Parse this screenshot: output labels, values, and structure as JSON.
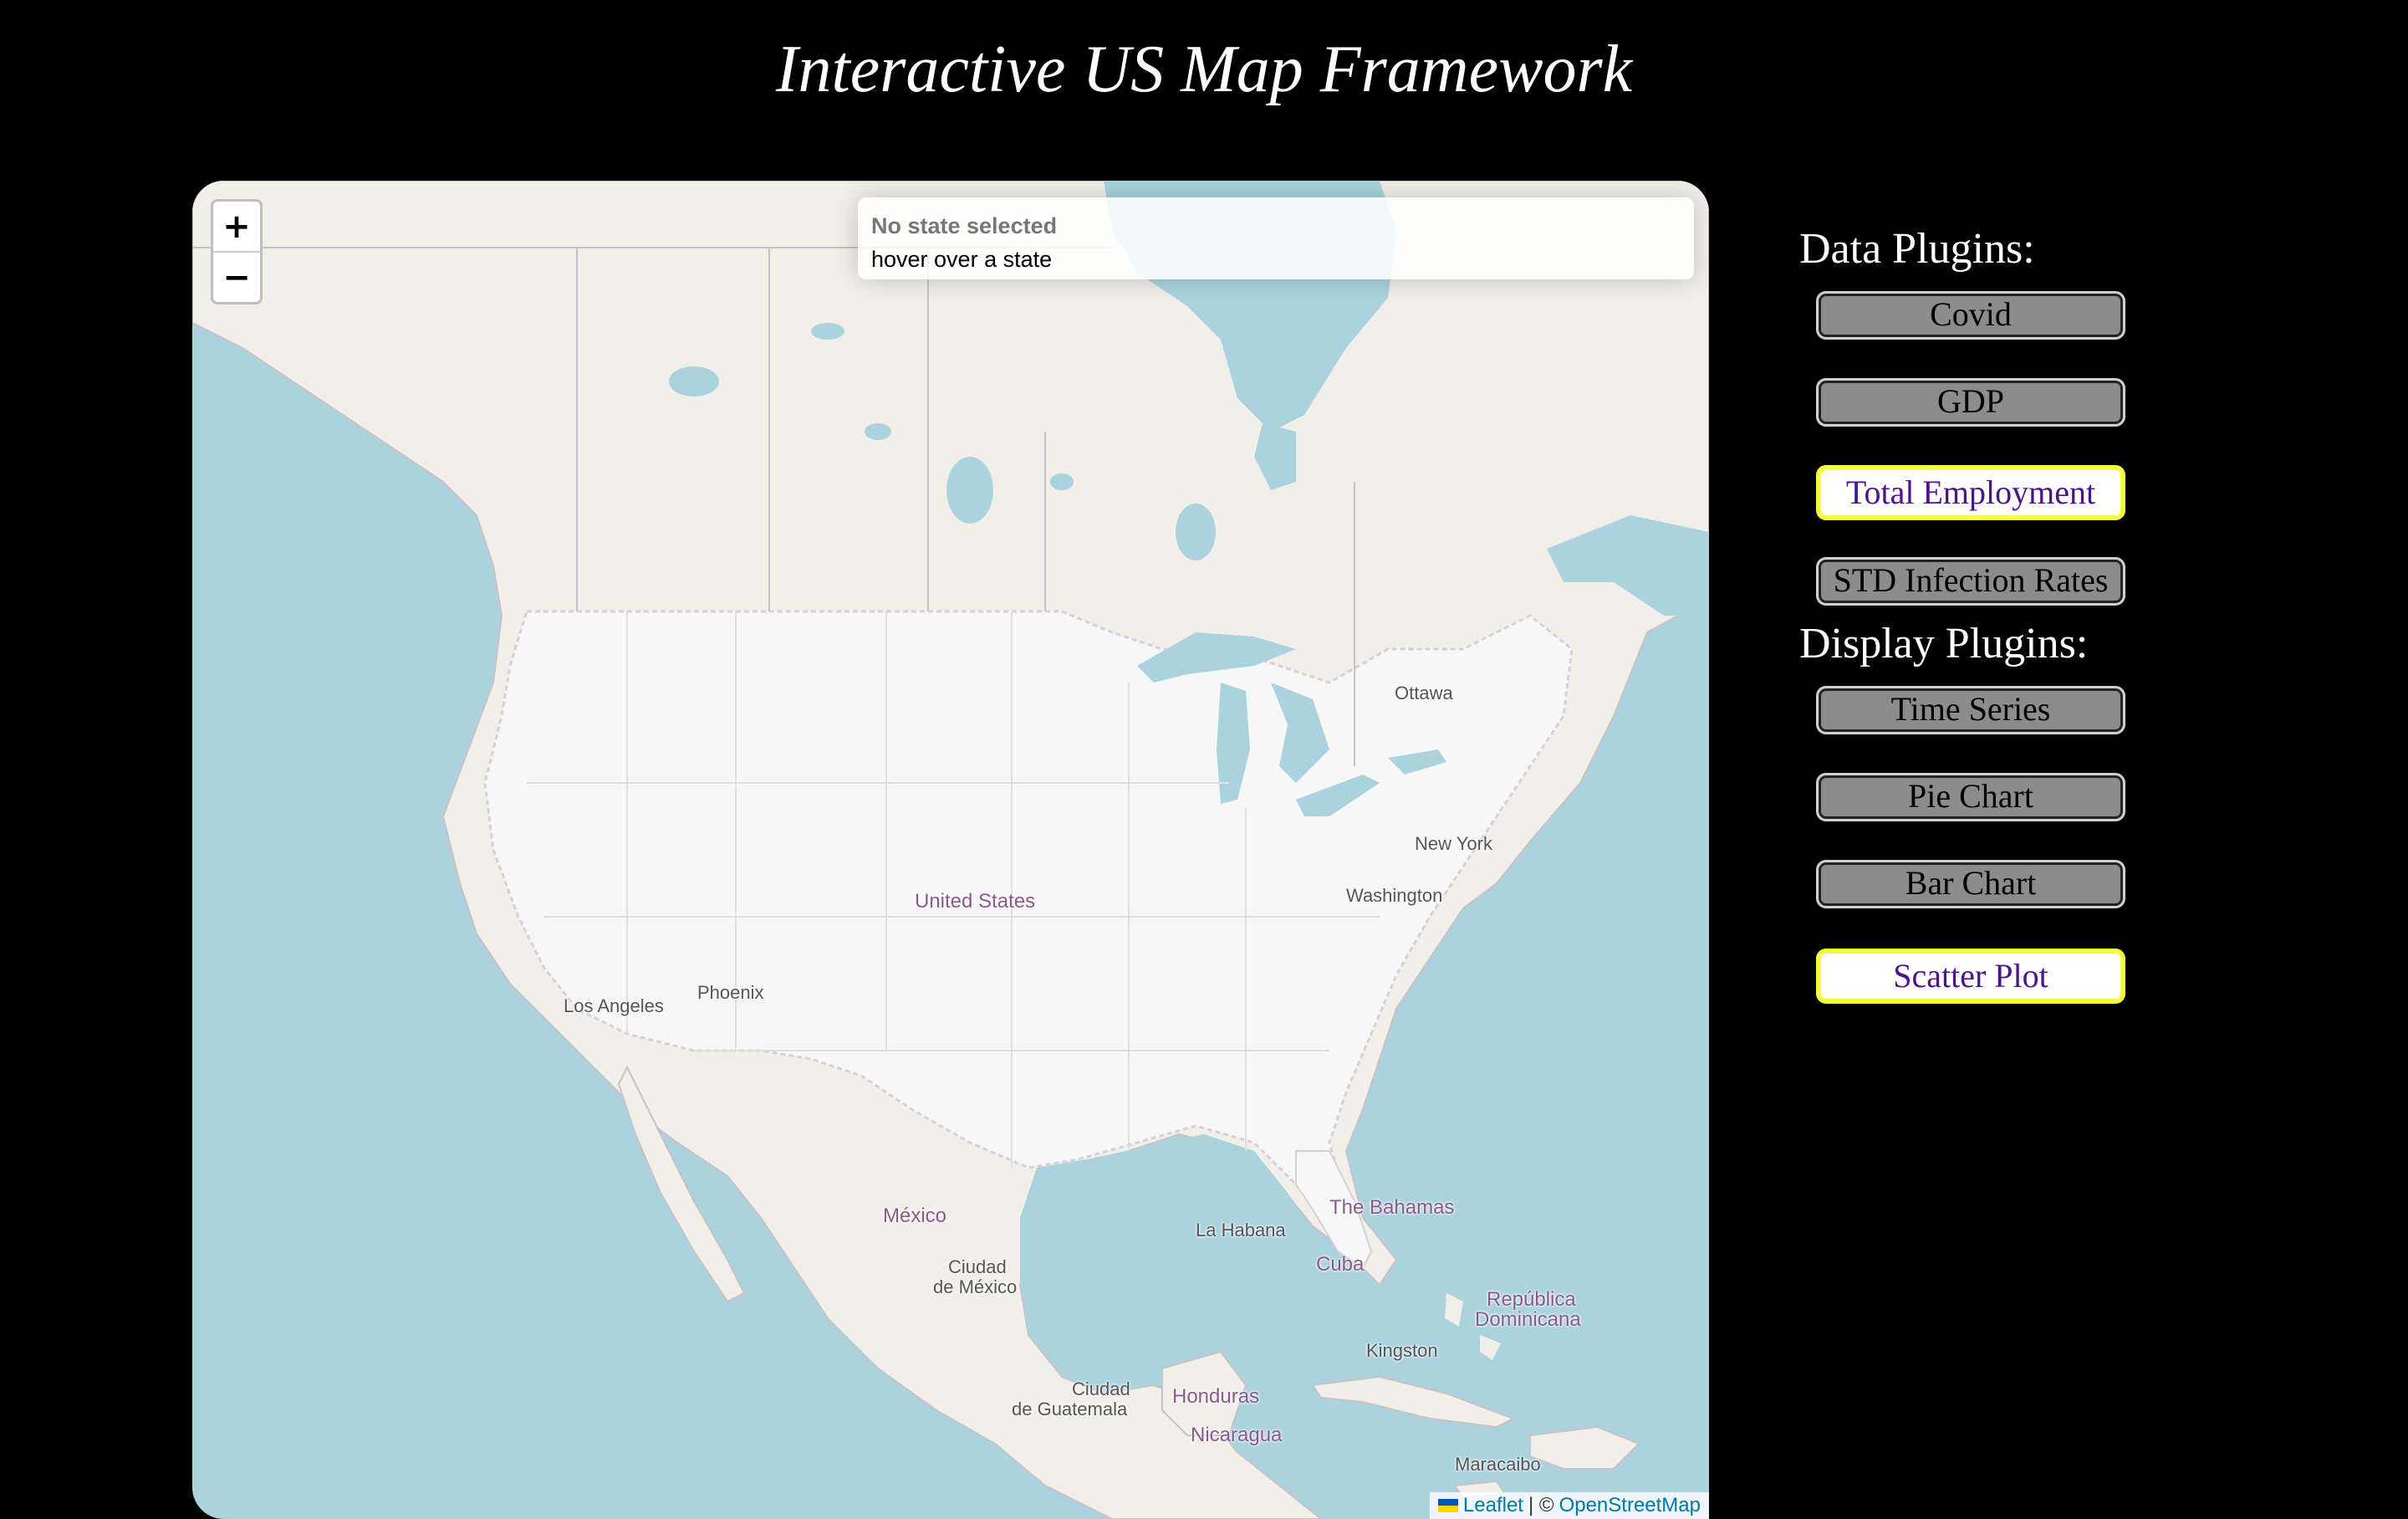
{
  "page": {
    "title": "Interactive US Map Framework"
  },
  "map": {
    "zoom_in": "+",
    "zoom_out": "−",
    "info": {
      "title": "No state selected",
      "subtitle": "hover over a state"
    },
    "attribution": {
      "leaflet": "Leaflet",
      "separator": "| ©",
      "osm": "OpenStreetMap"
    },
    "labels": {
      "ottawa": "Ottawa",
      "new_york": "New York",
      "washington": "Washington",
      "united_states": "United States",
      "phoenix": "Phoenix",
      "los_angeles": "Los Angeles",
      "mexico": "México",
      "ciudad_de_mexico_1": "Ciudad",
      "ciudad_de_mexico_2": "de México",
      "la_habana": "La Habana",
      "the_bahamas": "The Bahamas",
      "cuba": "Cuba",
      "republica_1": "República",
      "republica_2": "Dominicana",
      "kingston": "Kingston",
      "guatemala_1": "Ciudad",
      "guatemala_2": "de Guatemala",
      "honduras": "Honduras",
      "nicaragua": "Nicaragua",
      "maracaibo": "Maracaibo"
    }
  },
  "data_plugins": {
    "heading": "Data Plugins:",
    "items": [
      {
        "label": "Covid",
        "active": false
      },
      {
        "label": "GDP",
        "active": false
      },
      {
        "label": "Total Employment",
        "active": true
      },
      {
        "label": "STD Infection Rates",
        "active": false
      }
    ]
  },
  "display_plugins": {
    "heading": "Display Plugins:",
    "items": [
      {
        "label": "Time Series",
        "active": false
      },
      {
        "label": "Pie Chart",
        "active": false
      },
      {
        "label": "Bar Chart",
        "active": false
      },
      {
        "label": "Scatter Plot",
        "active": true
      }
    ]
  },
  "colors": {
    "background": "#000000",
    "water": "#aad3df",
    "land": "#f2efe9",
    "us_land": "#f7f7f7",
    "active_border": "#f3ff3c",
    "active_text": "#4b148c",
    "inactive_button": "#8c8c8c"
  }
}
